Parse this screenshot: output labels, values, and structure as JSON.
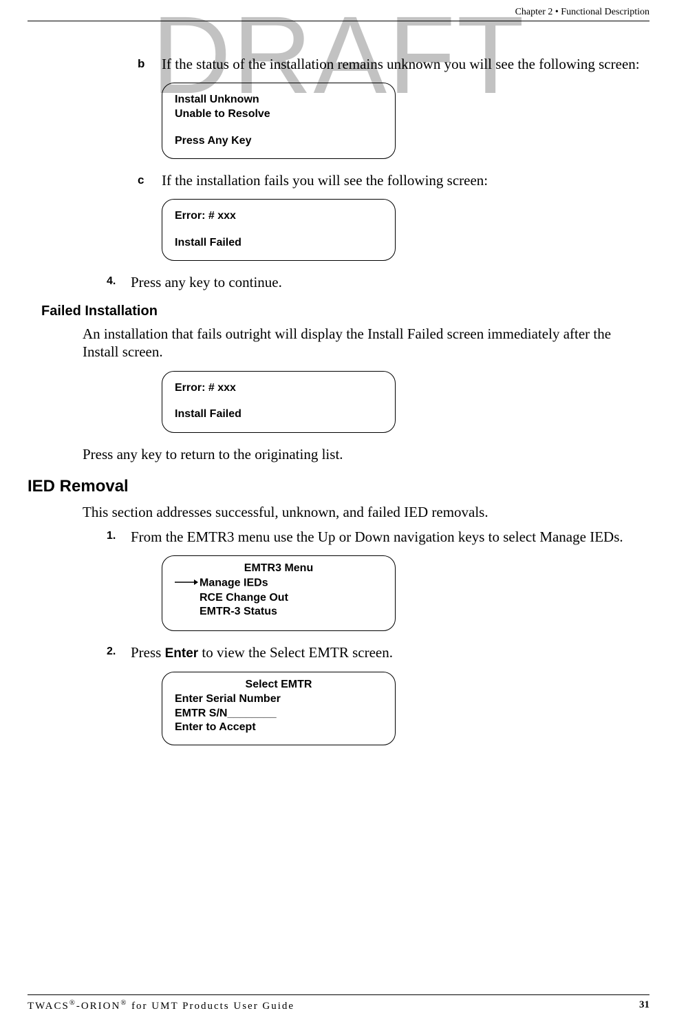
{
  "watermark": "DRAFT",
  "header": {
    "chapter": "Chapter 2 • Functional Description"
  },
  "item_b": {
    "marker": "b",
    "text": "If the status of the installation remains unknown you will see the following screen:"
  },
  "screen_b": {
    "line1": "Install Unknown",
    "line2": "Unable to Resolve",
    "line4": "Press Any Key"
  },
  "item_c": {
    "marker": "c",
    "text": "If the installation fails you will see the following screen:"
  },
  "screen_c": {
    "line1": "Error: # xxx",
    "line3": "Install Failed"
  },
  "item_4": {
    "marker": "4.",
    "text": "Press any key to continue."
  },
  "failed_heading": "Failed Installation",
  "failed_body": "An installation that fails outright will display the Install Failed screen immediately after the Install screen.",
  "screen_failed": {
    "line1": "Error: # xxx",
    "line3": "Install Failed"
  },
  "failed_return": "Press any key to return to the originating list.",
  "ied_heading": "IED Removal",
  "ied_body": "This section addresses successful, unknown, and failed IED removals.",
  "step1": {
    "marker": "1.",
    "text": "From the EMTR3 menu use the Up or Down navigation keys to select Manage IEDs."
  },
  "screen_emtr3": {
    "title": "EMTR3 Menu",
    "l1": "Manage IEDs",
    "l2": "RCE Change Out",
    "l3": "EMTR-3 Status"
  },
  "step2": {
    "marker": "2.",
    "pre": "Press ",
    "bold": "Enter",
    "post": " to view the Select EMTR screen."
  },
  "screen_select": {
    "title": "Select EMTR",
    "l1": "Enter Serial Number",
    "l2": "EMTR S/N________",
    "l3": "Enter to Accept"
  },
  "footer": {
    "left_a": "TWACS",
    "left_b": "-ORION",
    "left_c": " for UMT Products User Guide",
    "reg": "®",
    "page": "31"
  }
}
